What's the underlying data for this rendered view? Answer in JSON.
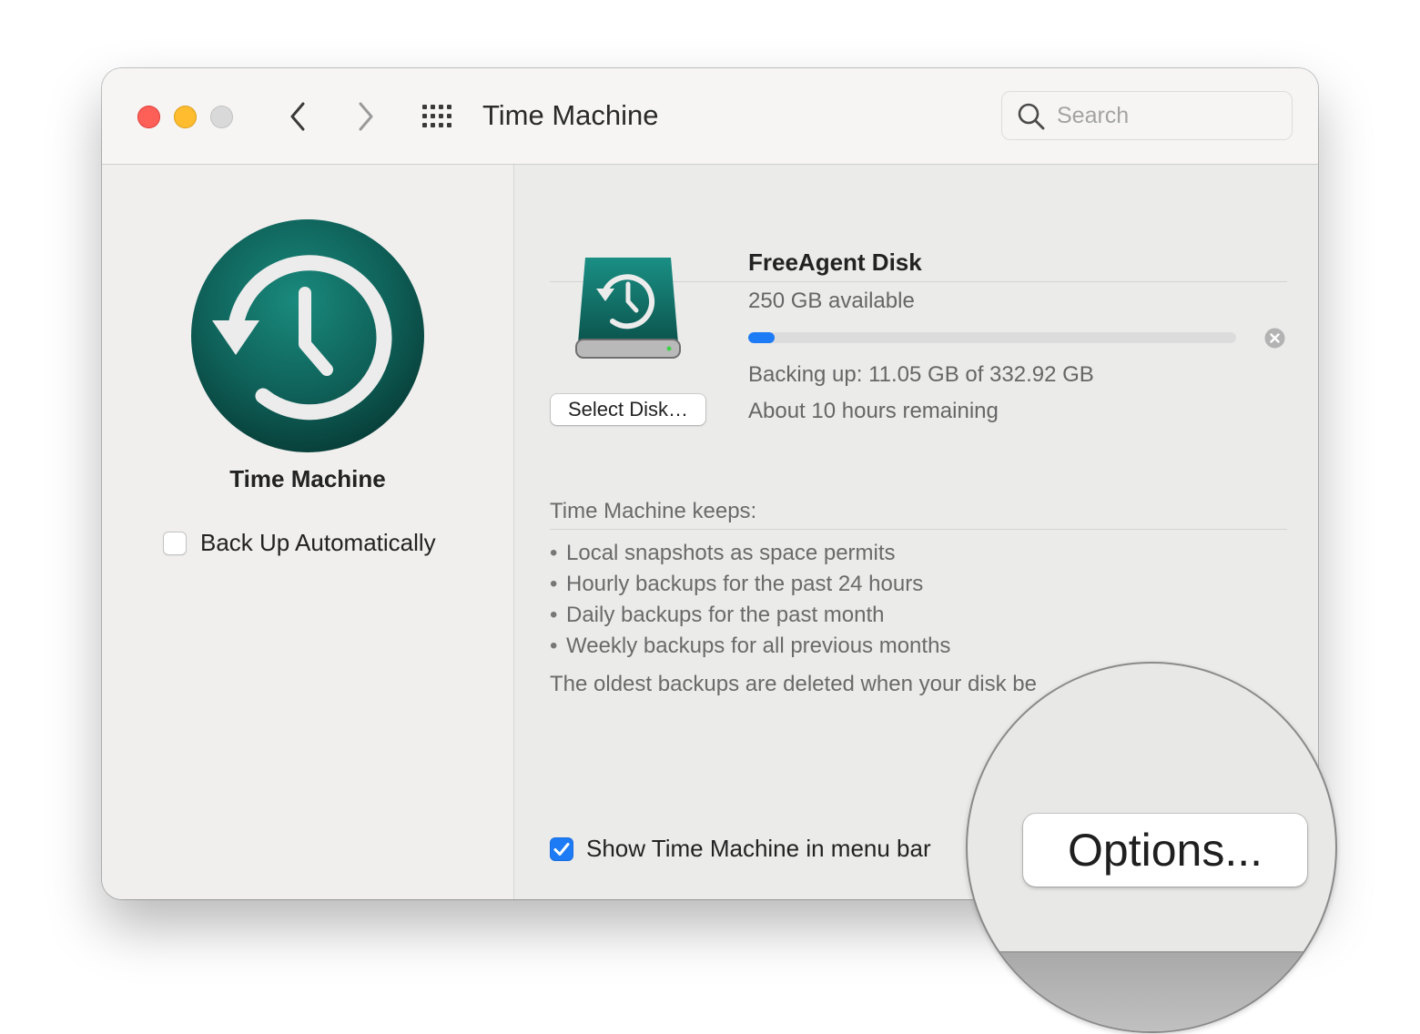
{
  "window": {
    "title": "Time Machine"
  },
  "search": {
    "placeholder": "Search"
  },
  "sidebar": {
    "app_name": "Time Machine",
    "back_up_automatically": {
      "label": "Back Up Automatically",
      "checked": false
    }
  },
  "disk": {
    "name": "FreeAgent Disk",
    "available": "250 GB available",
    "select_button": "Select Disk…",
    "progress_fraction": 0.055,
    "backing_up": "Backing up: 11.05 GB of 332.92 GB",
    "remaining": "About 10 hours remaining"
  },
  "keeps": {
    "title": "Time Machine keeps:",
    "items": [
      "Local snapshots as space permits",
      "Hourly backups for the past 24 hours",
      "Daily backups for the past month",
      "Weekly backups for all previous months"
    ],
    "oldest_note": "The oldest backups are deleted when your disk be"
  },
  "menubar_option": {
    "label": "Show Time Machine in menu bar",
    "checked": true
  },
  "options_button": {
    "label": "Options..."
  },
  "colors": {
    "accent": "#1d7bf5",
    "close": "#fe5f57",
    "minimize": "#febc2e",
    "zoom_disabled": "#d9d9d9",
    "logo_teal": "#0f6b62"
  }
}
